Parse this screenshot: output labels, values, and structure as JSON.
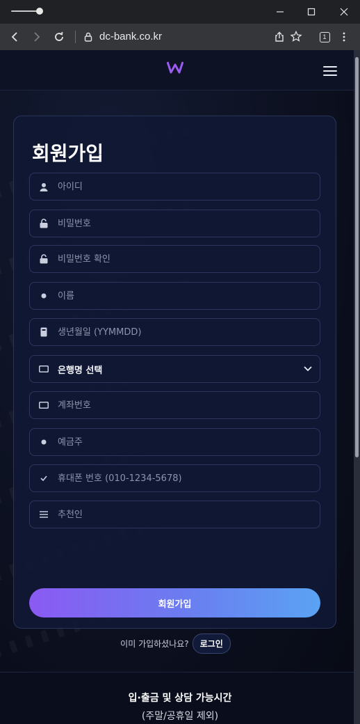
{
  "browser": {
    "url": "dc-bank.co.kr",
    "tab_count": "1"
  },
  "site": {
    "logo_icon": "w-logo-icon",
    "menu_icon": "hamburger-icon"
  },
  "signup": {
    "title": "회원가입",
    "fields": {
      "username": {
        "placeholder": "아이디",
        "icon": "user-icon"
      },
      "password": {
        "placeholder": "비밀번호",
        "icon": "lock-icon"
      },
      "password_confirm": {
        "placeholder": "비밀번호 확인",
        "icon": "lock-icon"
      },
      "name": {
        "placeholder": "이름",
        "icon": "dot-icon"
      },
      "birthdate": {
        "placeholder": "생년월일 (YYMMDD)",
        "icon": "calendar-icon"
      },
      "bank": {
        "selected": "은행명 선택",
        "icon": "card-icon"
      },
      "account": {
        "placeholder": "계좌번호",
        "icon": "card-icon"
      },
      "holder": {
        "placeholder": "예금주",
        "icon": "dot-icon"
      },
      "phone": {
        "placeholder": "휴대폰 번호 (010-1234-5678)",
        "icon": "check-icon"
      },
      "referrer": {
        "placeholder": "추천인",
        "icon": "list-icon"
      }
    },
    "submit_label": "회원가입",
    "login_prompt": "이미 가입하셨나요?",
    "login_label": "로그인"
  },
  "footer": {
    "title": "입·출금 및 상담 가능시간",
    "subtitle": "(주말/공휴일 제외)"
  },
  "colors": {
    "accent_start": "#8a5af2",
    "accent_end": "#5aa3f3",
    "card_bg": "#101834"
  }
}
